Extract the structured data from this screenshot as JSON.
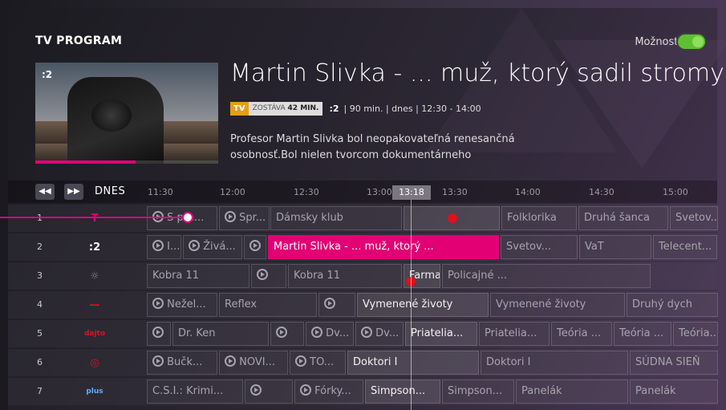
{
  "header": {
    "title": "TV PROGRAM",
    "options_label": "Možnosti",
    "options_toggle_on": true
  },
  "preview": {
    "channel_mark": ":2",
    "progress_fraction": 0.55,
    "show_title": "Martin Slivka - ... muž, ktorý sadil stromy",
    "badge_tv": "TV",
    "remaining_prefix": "ZOSTÁVA",
    "remaining_value": "42 MIN.",
    "channel_short": ":2",
    "details": "| 90 min. | dnes | 12:30 - 14:00",
    "description": "Profesor Martin Slivka bol neopakovateľná renesančná osobnosť.Bol nielen tvorcom dokumentárneho"
  },
  "timeline": {
    "back_icon": "rewind-icon",
    "forward_icon": "fast-forward-icon",
    "day_label": "DNES",
    "times": [
      "11:30",
      "12:00",
      "12:30",
      "13:00",
      "13:30",
      "14:00",
      "14:30",
      "15:00"
    ],
    "now_time": "13:18"
  },
  "rows": [
    {
      "num": "1",
      "logo": "TT",
      "logo_color": "#e20074",
      "cells": [
        {
          "text": "S pre...",
          "replay": true
        },
        {
          "text": "Spr...",
          "replay": true
        },
        {
          "text": "Dámsky klub",
          "replay": false
        },
        {
          "text": "",
          "replay": false,
          "record": true
        },
        {
          "text": "Folklorika",
          "replay": false
        },
        {
          "text": "Druhá šanca",
          "replay": false
        },
        {
          "text": "Svetov...",
          "replay": false
        }
      ]
    },
    {
      "num": "2",
      "logo": ":2",
      "logo_color": "#ffffff",
      "cells": [
        {
          "text": "I...",
          "replay": true
        },
        {
          "text": "Živá...",
          "replay": true
        },
        {
          "text": "",
          "replay": true
        },
        {
          "text": "Martin Slivka - ... muž, ktorý ...",
          "replay": false
        },
        {
          "text": "Svetov...",
          "replay": false
        },
        {
          "text": "VaT",
          "replay": false
        },
        {
          "text": "Telecent...",
          "replay": false
        }
      ]
    },
    {
      "num": "3",
      "logo": "joj-logo",
      "logo_color": "#888888",
      "cells": [
        {
          "text": "Kobra 11",
          "replay": false
        },
        {
          "text": "",
          "replay": true
        },
        {
          "text": "Kobra 11",
          "replay": false
        },
        {
          "text": "Farma",
          "replay": false
        },
        {
          "text": "Policajné ...",
          "replay": false
        }
      ]
    },
    {
      "num": "4",
      "logo": "markiza-logo",
      "logo_color": "#e0101e",
      "cells": [
        {
          "text": "Nežel...",
          "replay": true
        },
        {
          "text": "Reflex",
          "replay": false
        },
        {
          "text": "",
          "replay": true
        },
        {
          "text": "Vymenené životy",
          "replay": false
        },
        {
          "text": "Vymenené životy",
          "replay": false
        },
        {
          "text": "Druhý dych",
          "replay": false
        }
      ]
    },
    {
      "num": "5",
      "logo": "dajto",
      "logo_color": "#e0101e",
      "cells": [
        {
          "text": "",
          "replay": true
        },
        {
          "text": "Dr. Ken",
          "replay": false
        },
        {
          "text": "",
          "replay": true
        },
        {
          "text": "Dv...",
          "replay": true
        },
        {
          "text": "Dv...",
          "replay": true
        },
        {
          "text": "Priatelia...",
          "replay": false
        },
        {
          "text": "Priatelia...",
          "replay": false
        },
        {
          "text": "Teória ...",
          "replay": false
        },
        {
          "text": "Teória ...",
          "replay": false
        },
        {
          "text": "Teória...",
          "replay": false
        }
      ]
    },
    {
      "num": "6",
      "logo": "doma-logo",
      "logo_color": "#e0101e",
      "cells": [
        {
          "text": "Bučk...",
          "replay": true
        },
        {
          "text": "NOVI...",
          "replay": true
        },
        {
          "text": "TO...",
          "replay": true
        },
        {
          "text": "Doktori I",
          "replay": false
        },
        {
          "text": "Doktori I",
          "replay": false
        },
        {
          "text": "SÚDNA SIEŇ",
          "replay": false
        }
      ]
    },
    {
      "num": "7",
      "logo": "plus",
      "logo_color": "#5bb0ff",
      "cells": [
        {
          "text": "C.S.I.: Krimi...",
          "replay": false
        },
        {
          "text": "",
          "replay": true
        },
        {
          "text": "Fórky...",
          "replay": true
        },
        {
          "text": "Simpson...",
          "replay": false
        },
        {
          "text": "Simpson...",
          "replay": false
        },
        {
          "text": "Panelák",
          "replay": false
        },
        {
          "text": "Panelák",
          "replay": false
        }
      ]
    }
  ]
}
